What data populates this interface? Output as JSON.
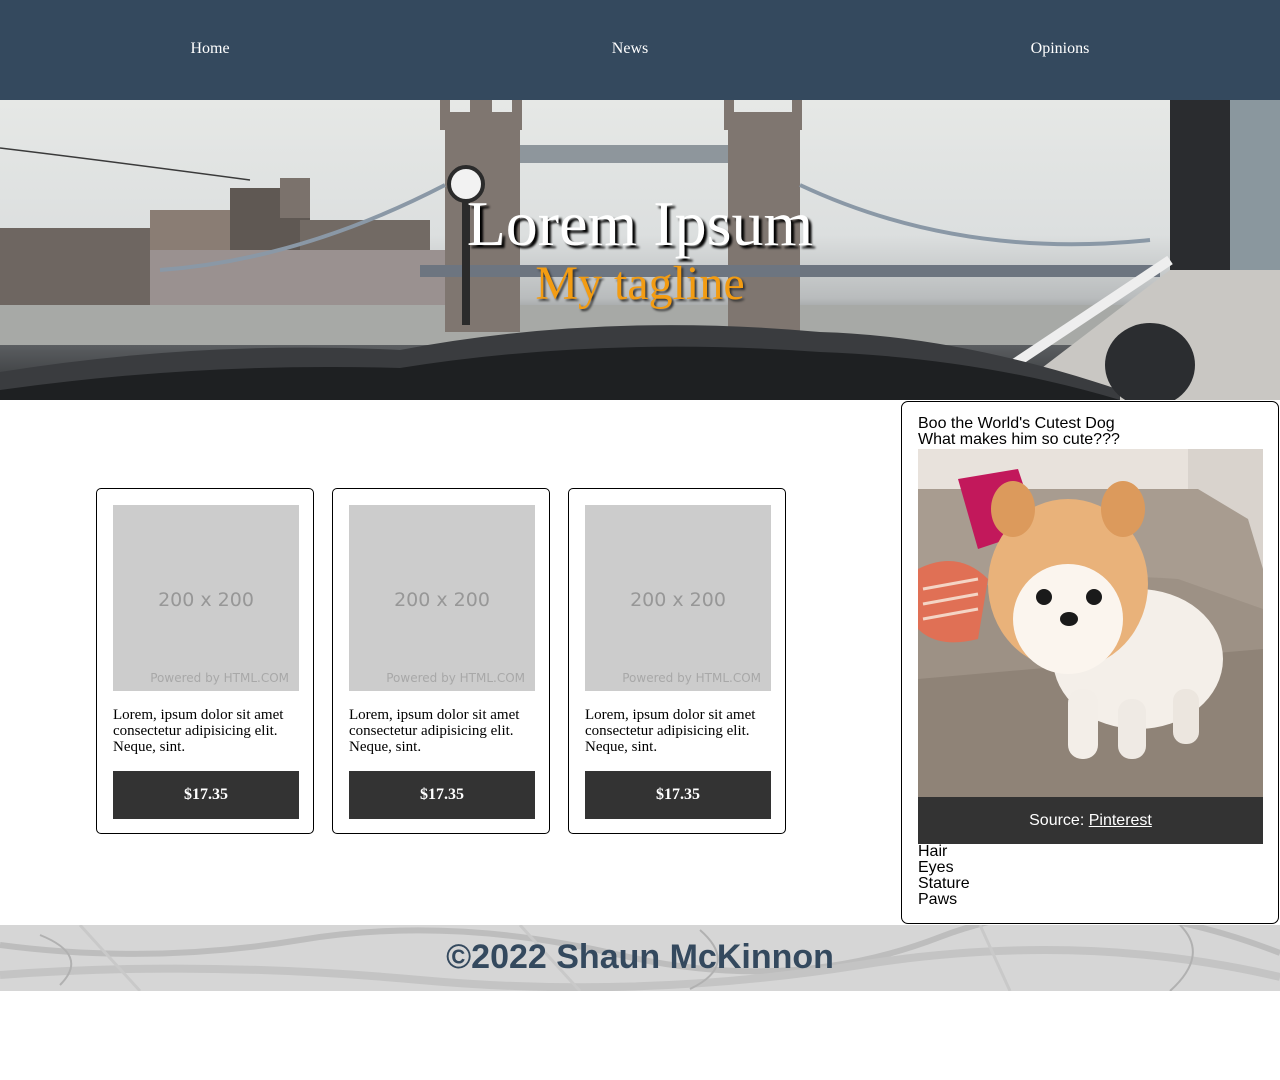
{
  "nav": {
    "items": [
      "Home",
      "News",
      "Opinions"
    ]
  },
  "hero": {
    "title": "Lorem Ipsum",
    "tagline": "My tagline"
  },
  "products": [
    {
      "placeholder_size": "200 x 200",
      "placeholder_credit": "Powered by HTML.COM",
      "description": "Lorem, ipsum dolor sit amet consectetur adipisicing elit. Neque, sint.",
      "price": "$17.35"
    },
    {
      "placeholder_size": "200 x 200",
      "placeholder_credit": "Powered by HTML.COM",
      "description": "Lorem, ipsum dolor sit amet consectetur adipisicing elit. Neque, sint.",
      "price": "$17.35"
    },
    {
      "placeholder_size": "200 x 200",
      "placeholder_credit": "Powered by HTML.COM",
      "description": "Lorem, ipsum dolor sit amet consectetur adipisicing elit. Neque, sint.",
      "price": "$17.35"
    }
  ],
  "sidebar": {
    "title": "Boo the World's Cutest Dog",
    "subtitle": "What makes him so cute???",
    "caption_prefix": "Source:",
    "caption_link": "Pinterest",
    "traits": [
      "Hair",
      "Eyes",
      "Stature",
      "Paws"
    ]
  },
  "footer": {
    "text": "©2022 Shaun McKinnon"
  },
  "colors": {
    "nav_bg": "#34495e",
    "tagline": "#f39c12",
    "button_bg": "#333333",
    "footer_text": "#34495e"
  }
}
